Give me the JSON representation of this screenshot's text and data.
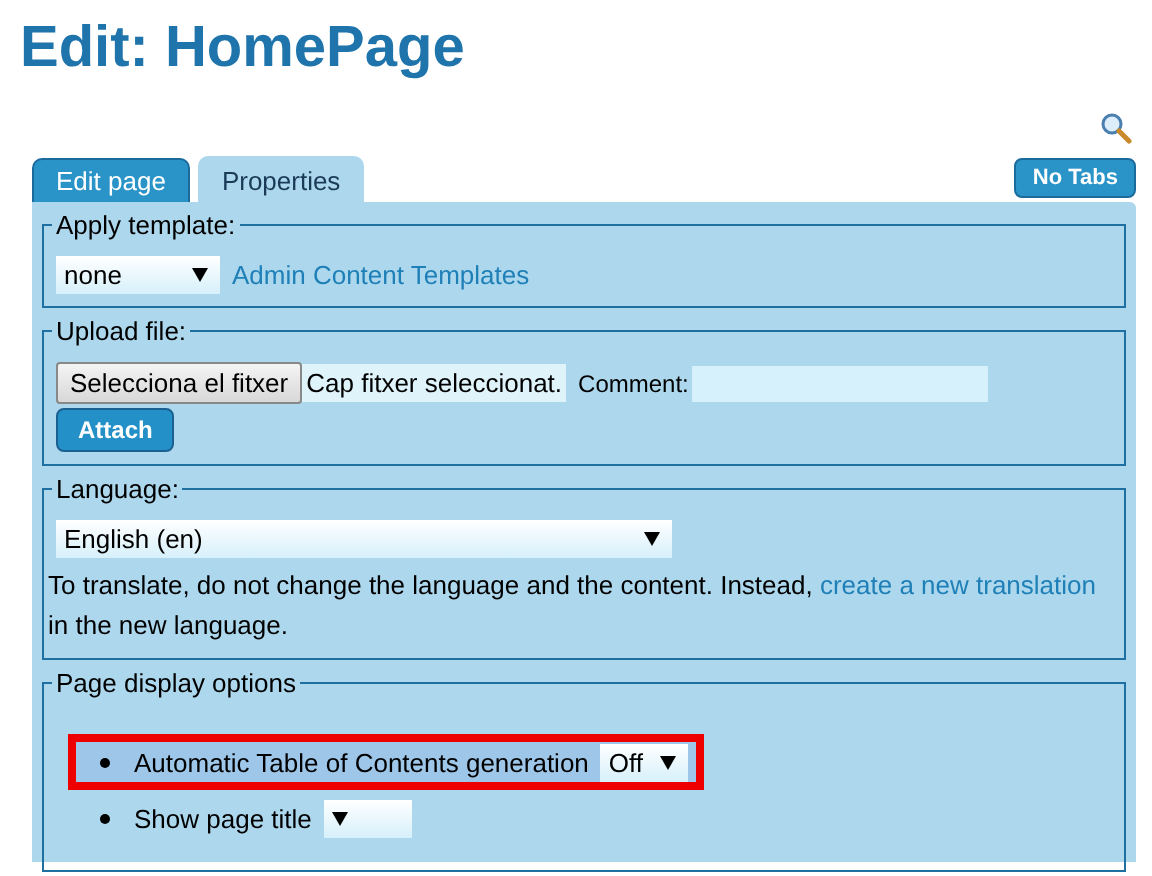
{
  "title": "Edit: HomePage",
  "tabs": [
    {
      "label": "Edit page",
      "selected": false
    },
    {
      "label": "Properties",
      "selected": true
    }
  ],
  "no_tabs_button": "No Tabs",
  "apply_template": {
    "legend": "Apply template:",
    "select": "none",
    "link": "Admin Content Templates"
  },
  "upload_file": {
    "legend": "Upload file:",
    "file_button": "Selecciona el fitxer",
    "file_status": "Cap fitxer seleccionat.",
    "comment_label": "Comment:",
    "attach_button": "Attach"
  },
  "language": {
    "legend": "Language:",
    "select": "English (en)",
    "note_before": "To translate, do not change the language and the content. Instead, ",
    "note_link": "create a new translation",
    "note_after": " in the new language."
  },
  "page_display_options": {
    "legend": "Page display options",
    "options": [
      {
        "label": "Automatic Table of Contents generation",
        "value": "Off",
        "highlighted": true
      },
      {
        "label": "Show page title",
        "highlighted": false
      }
    ]
  }
}
